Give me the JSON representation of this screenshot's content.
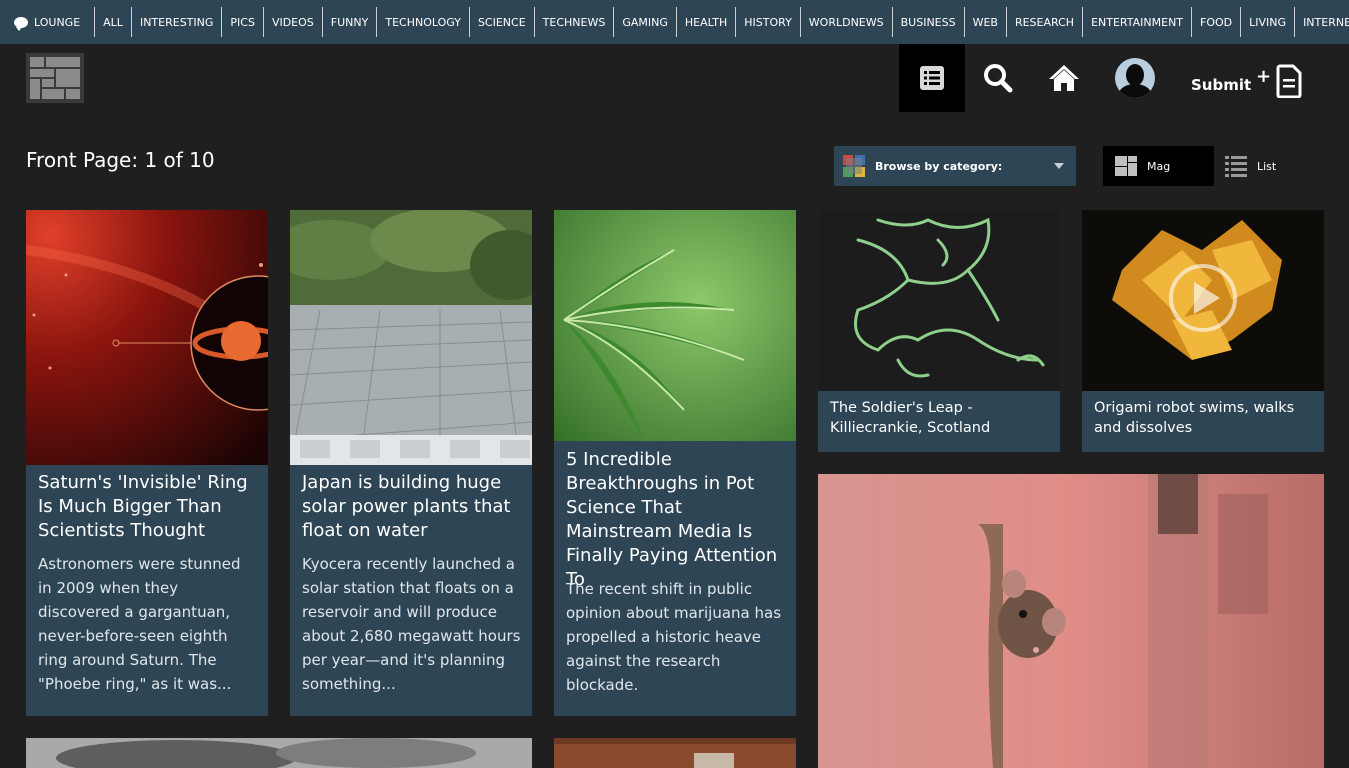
{
  "topnav": {
    "lounge": "LOUNGE",
    "links": [
      "ALL",
      "INTERESTING",
      "PICS",
      "VIDEOS",
      "FUNNY",
      "TECHNOLOGY",
      "SCIENCE",
      "TECHNEWS",
      "GAMING",
      "HEALTH",
      "HISTORY",
      "WORLDNEWS",
      "BUSINESS",
      "WEB",
      "RESEARCH",
      "ENTERTAINMENT",
      "FOOD",
      "LIVING",
      "INTERNET"
    ]
  },
  "header": {
    "submit_label": "Submit",
    "icons": [
      "logo-icon",
      "list-icon",
      "search-icon",
      "home-icon",
      "avatar",
      "submit-document-icon"
    ]
  },
  "page": {
    "title": "Front Page: 1 of 10",
    "browse_label": "Browse by category:",
    "view_mag": "Mag",
    "view_list": "List"
  },
  "cards": [
    {
      "title": "Saturn's 'Invisible' Ring Is Much Bigger Than Scientists Thought",
      "summary": "Astronomers were stunned in 2009 when they discovered a gargantuan, never-before-seen eighth ring around Saturn. The \"Phoebe ring,\" as it was..."
    },
    {
      "title": "Japan is building huge solar power plants that float on water",
      "summary": "Kyocera recently launched a solar station that floats on a reservoir and will produce about 2,680 megawatt hours per year—and it's planning something..."
    },
    {
      "title": "5 Incredible Breakthroughs in Pot Science That Mainstream Media Is Finally Paying Attention To",
      "summary": "The recent shift in public opinion about marijuana has propelled a historic heave against the research blockade."
    },
    {
      "title": "The Soldier's Leap - Killiecrankie, Scotland"
    },
    {
      "title": "Origami robot swims, walks and dissolves"
    }
  ],
  "colors": {
    "nav_bg": "#2e4556",
    "page_bg": "#1f1f1f",
    "card_bg": "#2e4556"
  }
}
